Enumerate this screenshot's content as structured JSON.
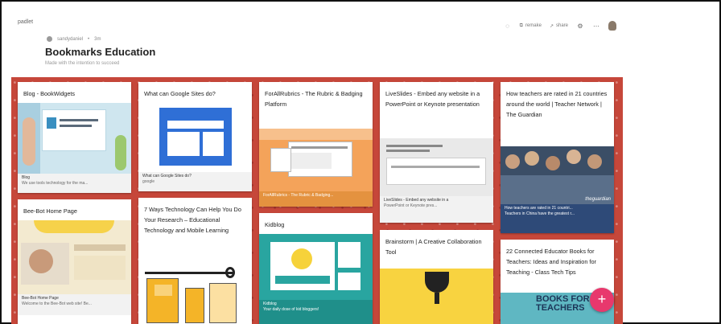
{
  "app": {
    "logo": "padlet"
  },
  "header": {
    "breadcrumb_user": "sandydaniel",
    "breadcrumb_sep": "•",
    "breadcrumb_time": "3m",
    "title": "Bookmarks Education",
    "subtitle": "Made with the intention to succeed"
  },
  "toolbar": {
    "share_label": "remake",
    "share2_label": "share"
  },
  "cards": [
    {
      "title": "Blog - BookWidgets",
      "foot1": "Blog",
      "foot2": "We use tools technology for the ma..."
    },
    {
      "title": "What can Google Sites do?",
      "foot1": "What can Google Sites do?",
      "foot2": "google"
    },
    {
      "title": "ForAllRubrics - The Rubric & Badging Platform",
      "foot1": "ForAllRubrics - The Rubric & Badging...",
      "foot2": ""
    },
    {
      "title": "LiveSlides - Embed any website in a PowerPoint or Keynote presentation",
      "foot1": "LiveSlides - Embed any website in a",
      "foot2": "PowerPoint or Keynote pres..."
    },
    {
      "title": "How teachers are rated in 21 countries around the world | Teacher Network | The Guardian",
      "foot1": "How teachers are rated in 21 countri...",
      "foot2": "Teachers in China have the greatest r...",
      "caption": "theguardian"
    },
    {
      "title": "Bee-Bot Home Page",
      "foot1": "Bee-Bot Home Page",
      "foot2": "Welcome to the Bee-Bot web site! Be..."
    },
    {
      "title": "7 Ways Technology Can Help You Do Your Research – Educational Technology and Mobile Learning",
      "foot1": "",
      "foot2": ""
    },
    {
      "title": "Kidblog",
      "foot1": "Kidblog",
      "foot2": "Your daily dose of kid bloggers!"
    },
    {
      "title": "Brainstorm | A Creative Collaboration Tool",
      "foot1": "",
      "foot2": ""
    },
    {
      "title": "22 Connected Educator Books for Teachers: Ideas and Inspiration for Teaching - Class Tech Tips",
      "foot1": "",
      "foot2": "",
      "caption": "BOOKS FOR TEACHERS"
    }
  ],
  "fab_label": "+",
  "colors": {
    "board": "#c6473a",
    "fab": "#e8386d"
  }
}
